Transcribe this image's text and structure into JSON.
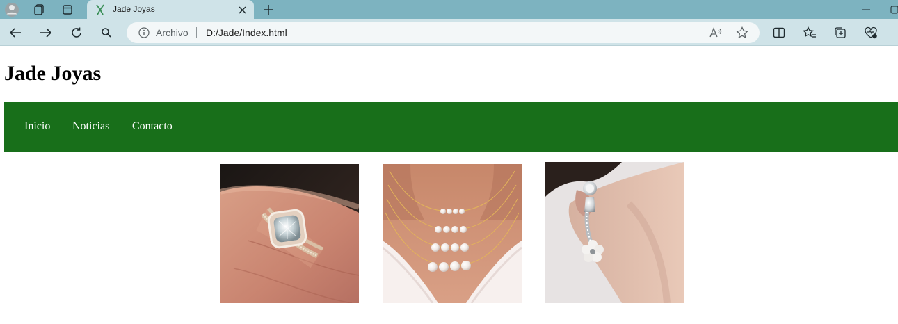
{
  "browser": {
    "tab": {
      "title": "Jade Joyas"
    },
    "address_bar": {
      "scheme_label": "Archivo",
      "url": "D:/Jade/Index.html"
    }
  },
  "page": {
    "title": "Jade Joyas",
    "nav": {
      "items": [
        "Inicio",
        "Noticias",
        "Contacto"
      ]
    },
    "gallery": [
      {
        "subject": "diamond-ring"
      },
      {
        "subject": "pearl-necklace"
      },
      {
        "subject": "pearl-earring"
      }
    ]
  },
  "colors": {
    "tab_strip": "#7db3c0",
    "toolbar": "#cfe3e8",
    "nav_background": "#186f1a",
    "nav_text": "#ffffff"
  }
}
